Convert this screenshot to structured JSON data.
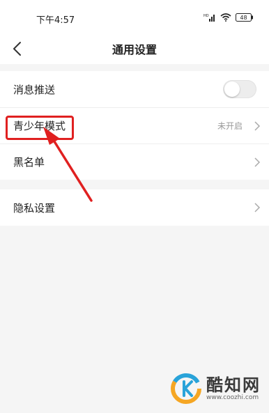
{
  "status_bar": {
    "time": "下午4:57",
    "battery": "48",
    "network": "HD"
  },
  "header": {
    "title": "通用设置",
    "back_icon": "chevron-left-icon"
  },
  "sections": {
    "first": [
      {
        "label": "消息推送",
        "control": "toggle",
        "enabled": false
      },
      {
        "label": "青少年模式",
        "value": "未开启",
        "control": "chevron"
      },
      {
        "label": "黑名单",
        "control": "chevron"
      }
    ],
    "second": [
      {
        "label": "隐私设置",
        "control": "chevron"
      }
    ]
  },
  "annotation": {
    "color": "#e02020",
    "target": "青少年模式"
  },
  "watermark": {
    "brand": "酷知网",
    "url": "www.coozhi.com"
  }
}
